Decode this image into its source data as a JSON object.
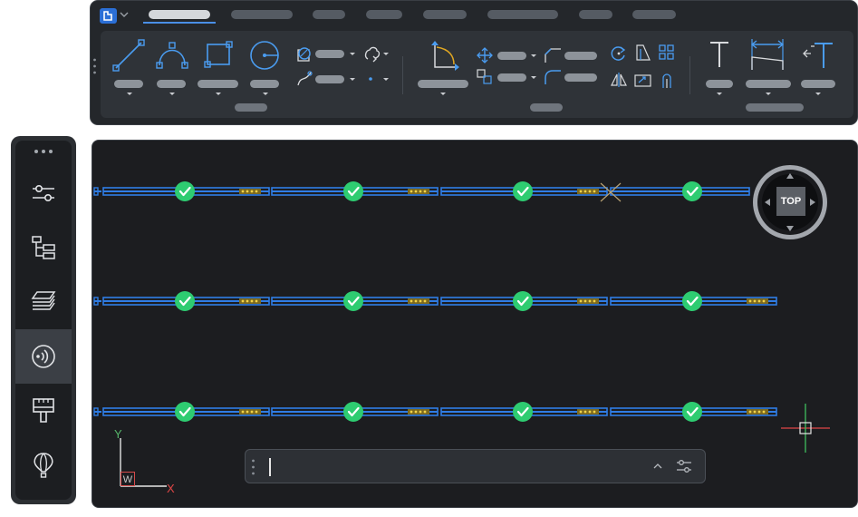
{
  "app": {
    "logo_icon": "bricscad-logo-icon",
    "accent_color": "#2b6fd6",
    "ribbon_tabs_count": 8
  },
  "viewcube": {
    "face_label": "TOP"
  },
  "command_line": {
    "value": "",
    "placeholder": ""
  },
  "ucs": {
    "x_label": "X",
    "y_label": "Y",
    "w_label": "W"
  },
  "sidebar": {
    "items": [
      {
        "name": "properties-icon"
      },
      {
        "name": "structure-browser-icon"
      },
      {
        "name": "layers-icon"
      },
      {
        "name": "bimify-icon",
        "active": true
      },
      {
        "name": "paint-brush-icon"
      },
      {
        "name": "balloon-icon"
      }
    ]
  },
  "drawing": {
    "status_color": "#2ecc71",
    "beam_color": "#2f7de6",
    "rows": 3,
    "checks_per_row": 4
  }
}
